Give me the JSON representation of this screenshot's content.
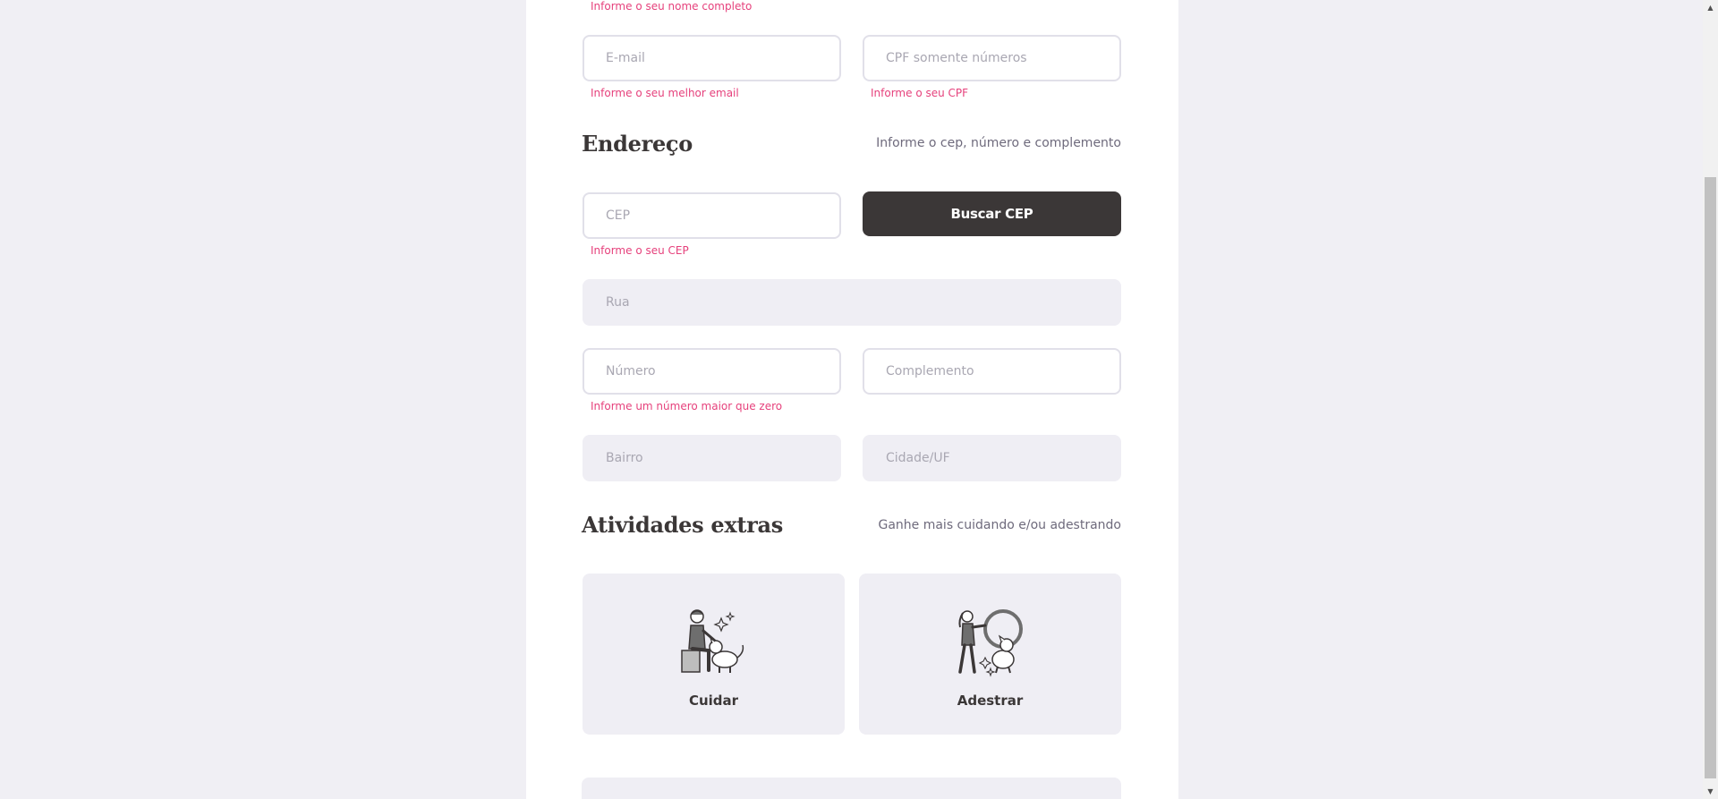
{
  "personal": {
    "name_error": "Informe o seu nome completo",
    "email_placeholder": "E-mail",
    "email_error": "Informe o seu melhor email",
    "cpf_placeholder": "CPF somente números",
    "cpf_error": "Informe o seu CPF"
  },
  "address": {
    "title": "Endereço",
    "hint": "Informe o cep, número e complemento",
    "cep_placeholder": "CEP",
    "cep_error": "Informe o seu CEP",
    "search_button": "Buscar CEP",
    "street_placeholder": "Rua",
    "number_placeholder": "Número",
    "number_error": "Informe um número maior que zero",
    "complement_placeholder": "Complemento",
    "district_placeholder": "Bairro",
    "city_placeholder": "Cidade/UF"
  },
  "activities": {
    "title": "Atividades extras",
    "hint": "Ganhe mais cuidando e/ou adestrando",
    "items": [
      {
        "label": "Cuidar",
        "icon": "pet-care-icon"
      },
      {
        "label": "Adestrar",
        "icon": "pet-training-icon"
      }
    ]
  },
  "colors": {
    "background": "#f0eff4",
    "panel": "#ffffff",
    "error": "#e6417c",
    "dark": "#3b3737",
    "field_disabled": "#efeef4"
  }
}
